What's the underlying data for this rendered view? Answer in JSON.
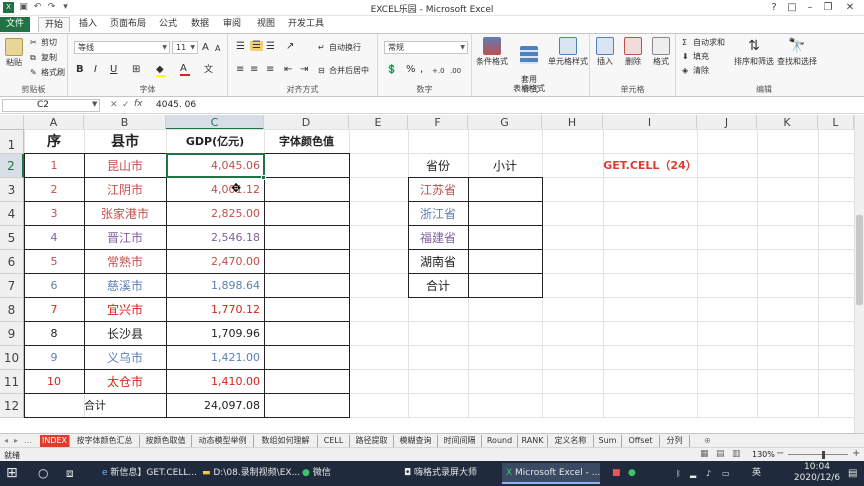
{
  "window": {
    "title": "EXCEL乐园 - Microsoft Excel",
    "quick_access": [
      "save-icon",
      "undo-icon",
      "redo-icon",
      "customize-icon"
    ],
    "controls": [
      "?",
      "□",
      "–",
      "❐",
      "✕"
    ]
  },
  "ribbon_tabs": [
    "文件",
    "开始",
    "插入",
    "页面布局",
    "公式",
    "数据",
    "审阅",
    "视图",
    "开发工具"
  ],
  "active_tab": "开始",
  "ribbon": {
    "clipboard": {
      "label": "剪贴板",
      "paste": "粘贴",
      "cut": "剪切",
      "copy": "复制",
      "painter": "格式刷"
    },
    "font": {
      "label": "字体",
      "name": "等线",
      "size": "11",
      "grow": "A",
      "shrink": "A",
      "bold": "B",
      "italic": "I",
      "underline": "U",
      "color_accent": "#d9231a",
      "fill_accent": "#ffff00"
    },
    "align": {
      "label": "对齐方式",
      "wrap": "自动换行",
      "merge": "合并后居中"
    },
    "number": {
      "label": "数字",
      "format": "常规",
      "percent": "%",
      "comma": ",",
      "inc": "+.0",
      "dec": ".00"
    },
    "styles": {
      "label": "样式",
      "cond": "条件格式",
      "table": "套用\n表格格式",
      "cell": "单元格样式"
    },
    "cells": {
      "label": "单元格",
      "insert": "插入",
      "delete": "删除",
      "format": "格式"
    },
    "editing": {
      "label": "编辑",
      "autosum": "自动求和",
      "fill": "填充",
      "clear": "清除",
      "sort": "排序和筛选",
      "find": "查找和选择"
    }
  },
  "formula_bar": {
    "name_box": "C2",
    "fx": "fx",
    "value": "4045. 06"
  },
  "columns": [
    "A",
    "B",
    "C",
    "D",
    "E",
    "F",
    "G",
    "H",
    "I",
    "J",
    "K",
    "L"
  ],
  "selected_column": "C",
  "rows": [
    "1",
    "2",
    "3",
    "4",
    "5",
    "6",
    "7",
    "8",
    "9",
    "10",
    "11",
    "12"
  ],
  "selected_row": "2",
  "table": {
    "headers": {
      "seq": "序",
      "county": "县市",
      "gdp": "GDP(亿元)",
      "font_color": "字体颜色值"
    },
    "records": [
      {
        "seq": "1",
        "county": "昆山市",
        "gdp": "4,045.06",
        "color": "#c0504d"
      },
      {
        "seq": "2",
        "county": "江阴市",
        "gdp": "4,001.12",
        "color": "#c0504d"
      },
      {
        "seq": "3",
        "county": "张家港市",
        "gdp": "2,825.00",
        "color": "#c0504d"
      },
      {
        "seq": "4",
        "county": "晋江市",
        "gdp": "2,546.18",
        "color": "#7f5fa0"
      },
      {
        "seq": "5",
        "county": "常熟市",
        "gdp": "2,470.00",
        "color": "#c0504d"
      },
      {
        "seq": "6",
        "county": "慈溪市",
        "gdp": "1,898.64",
        "color": "#5b7fb8"
      },
      {
        "seq": "7",
        "county": "宜兴市",
        "gdp": "1,770.12",
        "color": "#d9231a"
      },
      {
        "seq": "8",
        "county": "长沙县",
        "gdp": "1,709.96",
        "color": "#222222"
      },
      {
        "seq": "9",
        "county": "义乌市",
        "gdp": "1,421.00",
        "color": "#5b7fb8"
      },
      {
        "seq": "10",
        "county": "太仓市",
        "gdp": "1,410.00",
        "color": "#d9231a"
      }
    ],
    "total_label": "合计",
    "total_value": "24,097.08"
  },
  "summary": {
    "headers": {
      "province": "省份",
      "subtotal": "小计"
    },
    "provinces": [
      {
        "name": "江苏省",
        "color": "#c0504d"
      },
      {
        "name": "浙江省",
        "color": "#5b7fb8"
      },
      {
        "name": "福建省",
        "color": "#7f5fa0"
      },
      {
        "name": "湖南省",
        "color": "#222222"
      },
      {
        "name": "合计",
        "color": "#222222"
      }
    ]
  },
  "note": {
    "text": "GET.CELL（24）",
    "color": "#e03c2e"
  },
  "sheet_tabs": [
    "INDEX",
    "按字体颜色汇总",
    "按颜色取值",
    "动态模型举例",
    "数组如何理解",
    "CELL",
    "路径提取",
    "模糊查询",
    "时间间隔",
    "Round",
    "RANK",
    "定义名称",
    "Sum",
    "Offset",
    "分列"
  ],
  "active_sheet": "INDEX",
  "status": {
    "ready": "就绪",
    "zoom": "130%"
  },
  "taskbar": {
    "items": [
      "新信息】GET.CELL...",
      "D:\\08.录制视频\\EX...",
      "微信",
      "嗨格式录屏大师",
      "Microsoft Excel - ..."
    ],
    "active": "Microsoft Excel - ...",
    "ime": "英",
    "time": "10:04",
    "date": "2020/12/6"
  }
}
